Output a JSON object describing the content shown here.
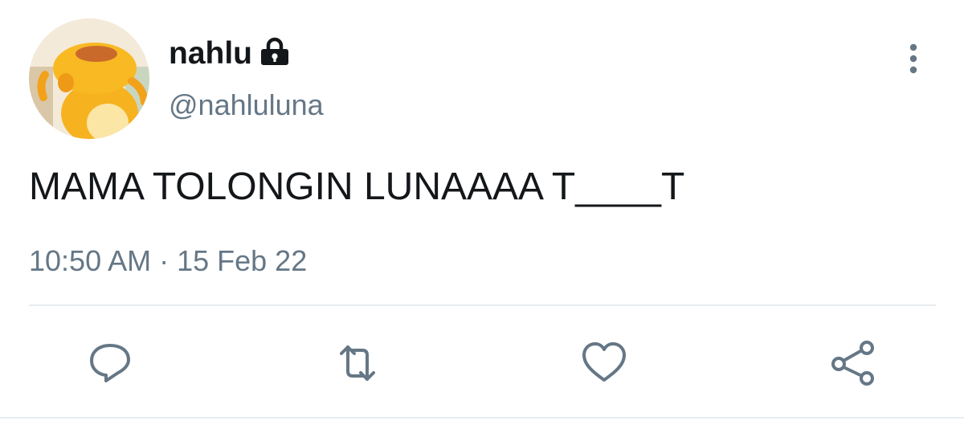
{
  "tweet": {
    "display_name": "nahlu",
    "handle": "@nahluluna",
    "protected_icon": "lock-icon",
    "text": "MAMA TOLONGIN LUNAAAA T____T",
    "timestamp": "10:50 AM · 15 Feb 22",
    "menu_icon": "more-vertical-icon"
  },
  "actions": [
    {
      "name": "reply",
      "icon": "reply-icon"
    },
    {
      "name": "retweet",
      "icon": "retweet-icon"
    },
    {
      "name": "like",
      "icon": "heart-icon"
    },
    {
      "name": "share",
      "icon": "share-icon"
    }
  ],
  "colors": {
    "text_primary": "#14171a",
    "text_secondary": "#657786",
    "icon": "#657786",
    "divider": "#e6ecf0"
  }
}
